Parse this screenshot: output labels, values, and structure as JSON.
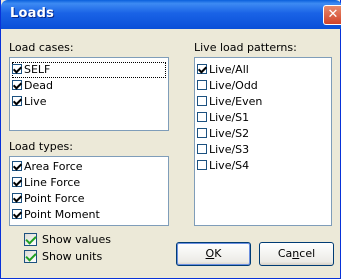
{
  "window": {
    "title": "Loads",
    "close_symbol": "✕"
  },
  "load_cases": {
    "label": "Load cases:",
    "items": [
      {
        "label": "SELF",
        "checked": true
      },
      {
        "label": "Dead",
        "checked": true
      },
      {
        "label": "Live",
        "checked": true
      }
    ]
  },
  "load_types": {
    "label": "Load types:",
    "items": [
      {
        "label": "Area Force",
        "checked": true
      },
      {
        "label": "Line Force",
        "checked": true
      },
      {
        "label": "Point Force",
        "checked": true
      },
      {
        "label": "Point Moment",
        "checked": true
      }
    ]
  },
  "live_load_patterns": {
    "label": "Live load patterns:",
    "items": [
      {
        "label": "Live/All",
        "checked": true
      },
      {
        "label": "Live/Odd",
        "checked": false
      },
      {
        "label": "Live/Even",
        "checked": false
      },
      {
        "label": "Live/S1",
        "checked": false
      },
      {
        "label": "Live/S2",
        "checked": false
      },
      {
        "label": "Live/S3",
        "checked": false
      },
      {
        "label": "Live/S4",
        "checked": false
      }
    ]
  },
  "options": {
    "show_values": {
      "label": "Show values",
      "checked": true
    },
    "show_units": {
      "label": "Show units",
      "checked": true
    }
  },
  "buttons": {
    "ok": {
      "mnemonic": "O",
      "rest": "K"
    },
    "cancel": {
      "prefix": "Ca",
      "mnemonic": "n",
      "rest": "cel"
    }
  }
}
